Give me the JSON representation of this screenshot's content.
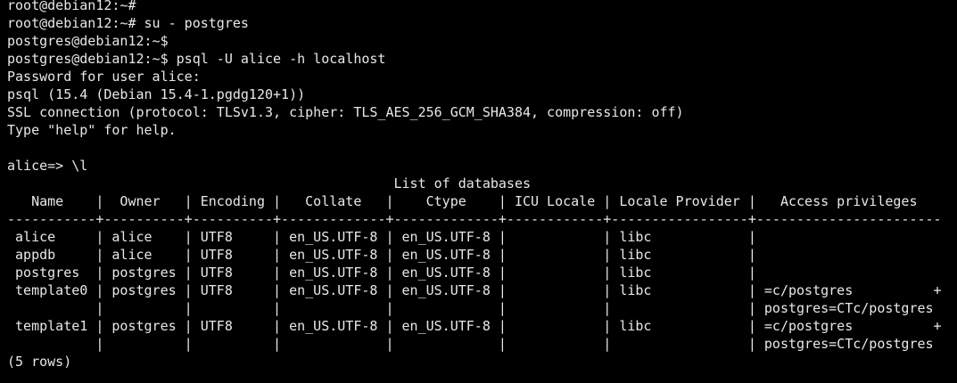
{
  "terminal": {
    "lines": [
      "root@debian12:~#",
      "root@debian12:~# su - postgres",
      "postgres@debian12:~$",
      "postgres@debian12:~$ psql -U alice -h localhost",
      "Password for user alice:",
      "psql (15.4 (Debian 15.4-1.pgdg120+1))",
      "SSL connection (protocol: TLSv1.3, cipher: TLS_AES_256_GCM_SHA384, compression: off)",
      "Type \"help\" for help.",
      "",
      "alice=> \\l",
      "                                                List of databases",
      "   Name    |  Owner   | Encoding |   Collate   |    Ctype    | ICU Locale | Locale Provider |   Access privileges",
      "-----------+----------+----------+-------------+-------------+------------+-----------------+-----------------------",
      " alice     | alice    | UTF8     | en_US.UTF-8 | en_US.UTF-8 |            | libc            |",
      " appdb     | alice    | UTF8     | en_US.UTF-8 | en_US.UTF-8 |            | libc            |",
      " postgres  | postgres | UTF8     | en_US.UTF-8 | en_US.UTF-8 |            | libc            |",
      " template0 | postgres | UTF8     | en_US.UTF-8 | en_US.UTF-8 |            | libc            | =c/postgres          +",
      "           |          |          |             |             |            |                 | postgres=CTc/postgres",
      " template1 | postgres | UTF8     | en_US.UTF-8 | en_US.UTF-8 |            | libc            | =c/postgres          +",
      "           |          |          |             |             |            |                 | postgres=CTc/postgres",
      "(5 rows)"
    ]
  },
  "colors": {
    "background": "#000000",
    "foreground": "#e8e8e8"
  }
}
